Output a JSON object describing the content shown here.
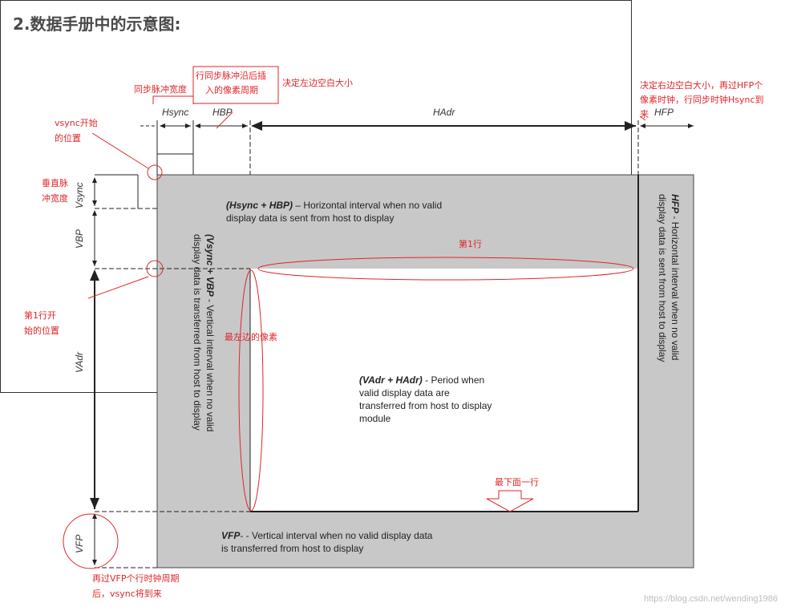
{
  "heading": "2.数据手册中的示意图:",
  "labels": {
    "hsync": "Hsync",
    "hbp": "HBP",
    "hadr": "HAdr",
    "hfp": "HFP",
    "vsync": "Vsync",
    "vbp": "VBP",
    "vadr": "VAdr",
    "vfp": "VFP"
  },
  "descriptions": {
    "h_blank_bold": "(Hsync + HBP)",
    "h_blank_text": "– Horizontal interval when no valid display data is sent from host to display",
    "v_blank_bold": "(Vsync + VBP",
    "v_blank_text": "- Vertical interval when no valid display data is transferred from host to display",
    "active_bold": "(VAdr + HAdr)",
    "active_text": "- Period when valid display data are transferred from host to display module",
    "hfp_bold": "HFP",
    "hfp_text": "- Horizontal interval when no valid display data is sent from host to display",
    "vfp_bold": "VFP",
    "vfp_text": "- - Vertical interval when no valid display data is transferred from host to display"
  },
  "annotations": {
    "hsync_width": "同步脉冲宽度",
    "hbp_note_1": "行同步脉冲沿后插",
    "hbp_note_2": "入的像素周期",
    "left_blank": "决定左边空白大小",
    "right_blank_1": "决定右边空白大小，再过HFP个",
    "right_blank_2": "像素时钟，行同步时钟Hsync到",
    "right_blank_3": "来",
    "vsync_start_1": "vsync开始",
    "vsync_start_2": "的位置",
    "vsync_width_1": "垂直脉",
    "vsync_width_2": "冲宽度",
    "row1_start_1": "第1行开",
    "row1_start_2": "始的位置",
    "row1": "第1行",
    "leftmost_pixel": "最左边的像素",
    "bottom_row": "最下面一行",
    "vfp_note_1": "再过VFP个行时钟周期",
    "vfp_note_2": "后，vsync将到来"
  },
  "watermark": "https://blog.csdn.net/wending1986",
  "colors": {
    "panel": "#c8c8c8",
    "annotation": "#e0262a",
    "line": "#333333"
  }
}
